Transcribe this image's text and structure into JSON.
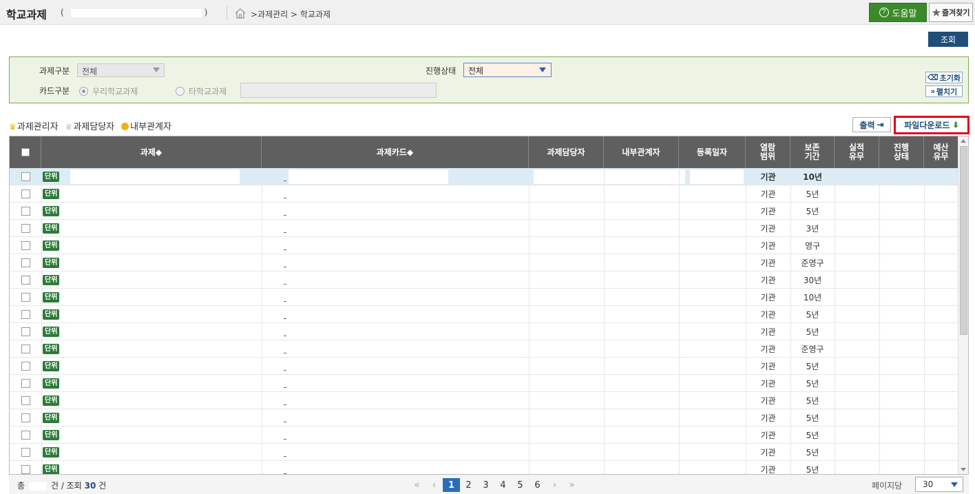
{
  "header": {
    "title": "학교과제",
    "paren_open": "(",
    "paren_close": ")",
    "breadcrumb": ">과제관리 > 학교과제",
    "help_label": "도움말",
    "favorites_label": "즐겨찾기"
  },
  "search": {
    "button_label": "조회",
    "task_type_label": "과제구분",
    "task_type_value": "전체",
    "status_label": "진행상태",
    "status_value": "전체",
    "card_type_label": "카드구분",
    "card_option_ours": "우리학교과제",
    "card_option_other": "타학교과제",
    "reset_label": "초기화",
    "expand_label": "펼치기"
  },
  "legend": {
    "manager": "과제관리자",
    "assignee": "과제담당자",
    "internal": "내부관계자"
  },
  "actions": {
    "print_label": "출력",
    "download_label": "파일다운로드"
  },
  "table": {
    "columns": [
      "과제◆",
      "과제카드◆",
      "과제담당자",
      "내부관계자",
      "등록일자",
      "열람\n범위",
      "보존\n기간",
      "실적\n유무",
      "진행\n상태",
      "예산\n유무"
    ],
    "rows": [
      {
        "badge": "단위",
        "scope": "기관",
        "period": "10년"
      },
      {
        "badge": "단위",
        "scope": "기관",
        "period": "5년"
      },
      {
        "badge": "단위",
        "scope": "기관",
        "period": "5년"
      },
      {
        "badge": "단위",
        "scope": "기관",
        "period": "3년"
      },
      {
        "badge": "단위",
        "scope": "기관",
        "period": "영구"
      },
      {
        "badge": "단위",
        "scope": "기관",
        "period": "준영구"
      },
      {
        "badge": "단위",
        "scope": "기관",
        "period": "30년"
      },
      {
        "badge": "단위",
        "scope": "기관",
        "period": "10년"
      },
      {
        "badge": "단위",
        "scope": "기관",
        "period": "5년"
      },
      {
        "badge": "단위",
        "scope": "기관",
        "period": "5년"
      },
      {
        "badge": "단위",
        "scope": "기관",
        "period": "준영구"
      },
      {
        "badge": "단위",
        "scope": "기관",
        "period": "5년"
      },
      {
        "badge": "단위",
        "scope": "기관",
        "period": "5년"
      },
      {
        "badge": "단위",
        "scope": "기관",
        "period": "5년"
      },
      {
        "badge": "단위",
        "scope": "기관",
        "period": "5년"
      },
      {
        "badge": "단위",
        "scope": "기관",
        "period": "5년"
      },
      {
        "badge": "단위",
        "scope": "기관",
        "period": "5년"
      },
      {
        "badge": "단위",
        "scope": "기관",
        "period": "5년"
      }
    ],
    "selected_row": 0
  },
  "footer": {
    "total_prefix": "총",
    "total_suffix": "건 / 조회",
    "shown_count": "30",
    "count_unit": "건",
    "pages": [
      "1",
      "2",
      "3",
      "4",
      "5",
      "6"
    ],
    "current_page": "1",
    "per_page_label": "페이지당",
    "per_page_value": "30"
  },
  "colors": {
    "header_bg": "#5f5f5f",
    "accent_blue": "#1f4e79",
    "badge_green": "#2c7a3a",
    "highlight_red": "#e0001b",
    "filter_bg": "#eef4e4"
  }
}
